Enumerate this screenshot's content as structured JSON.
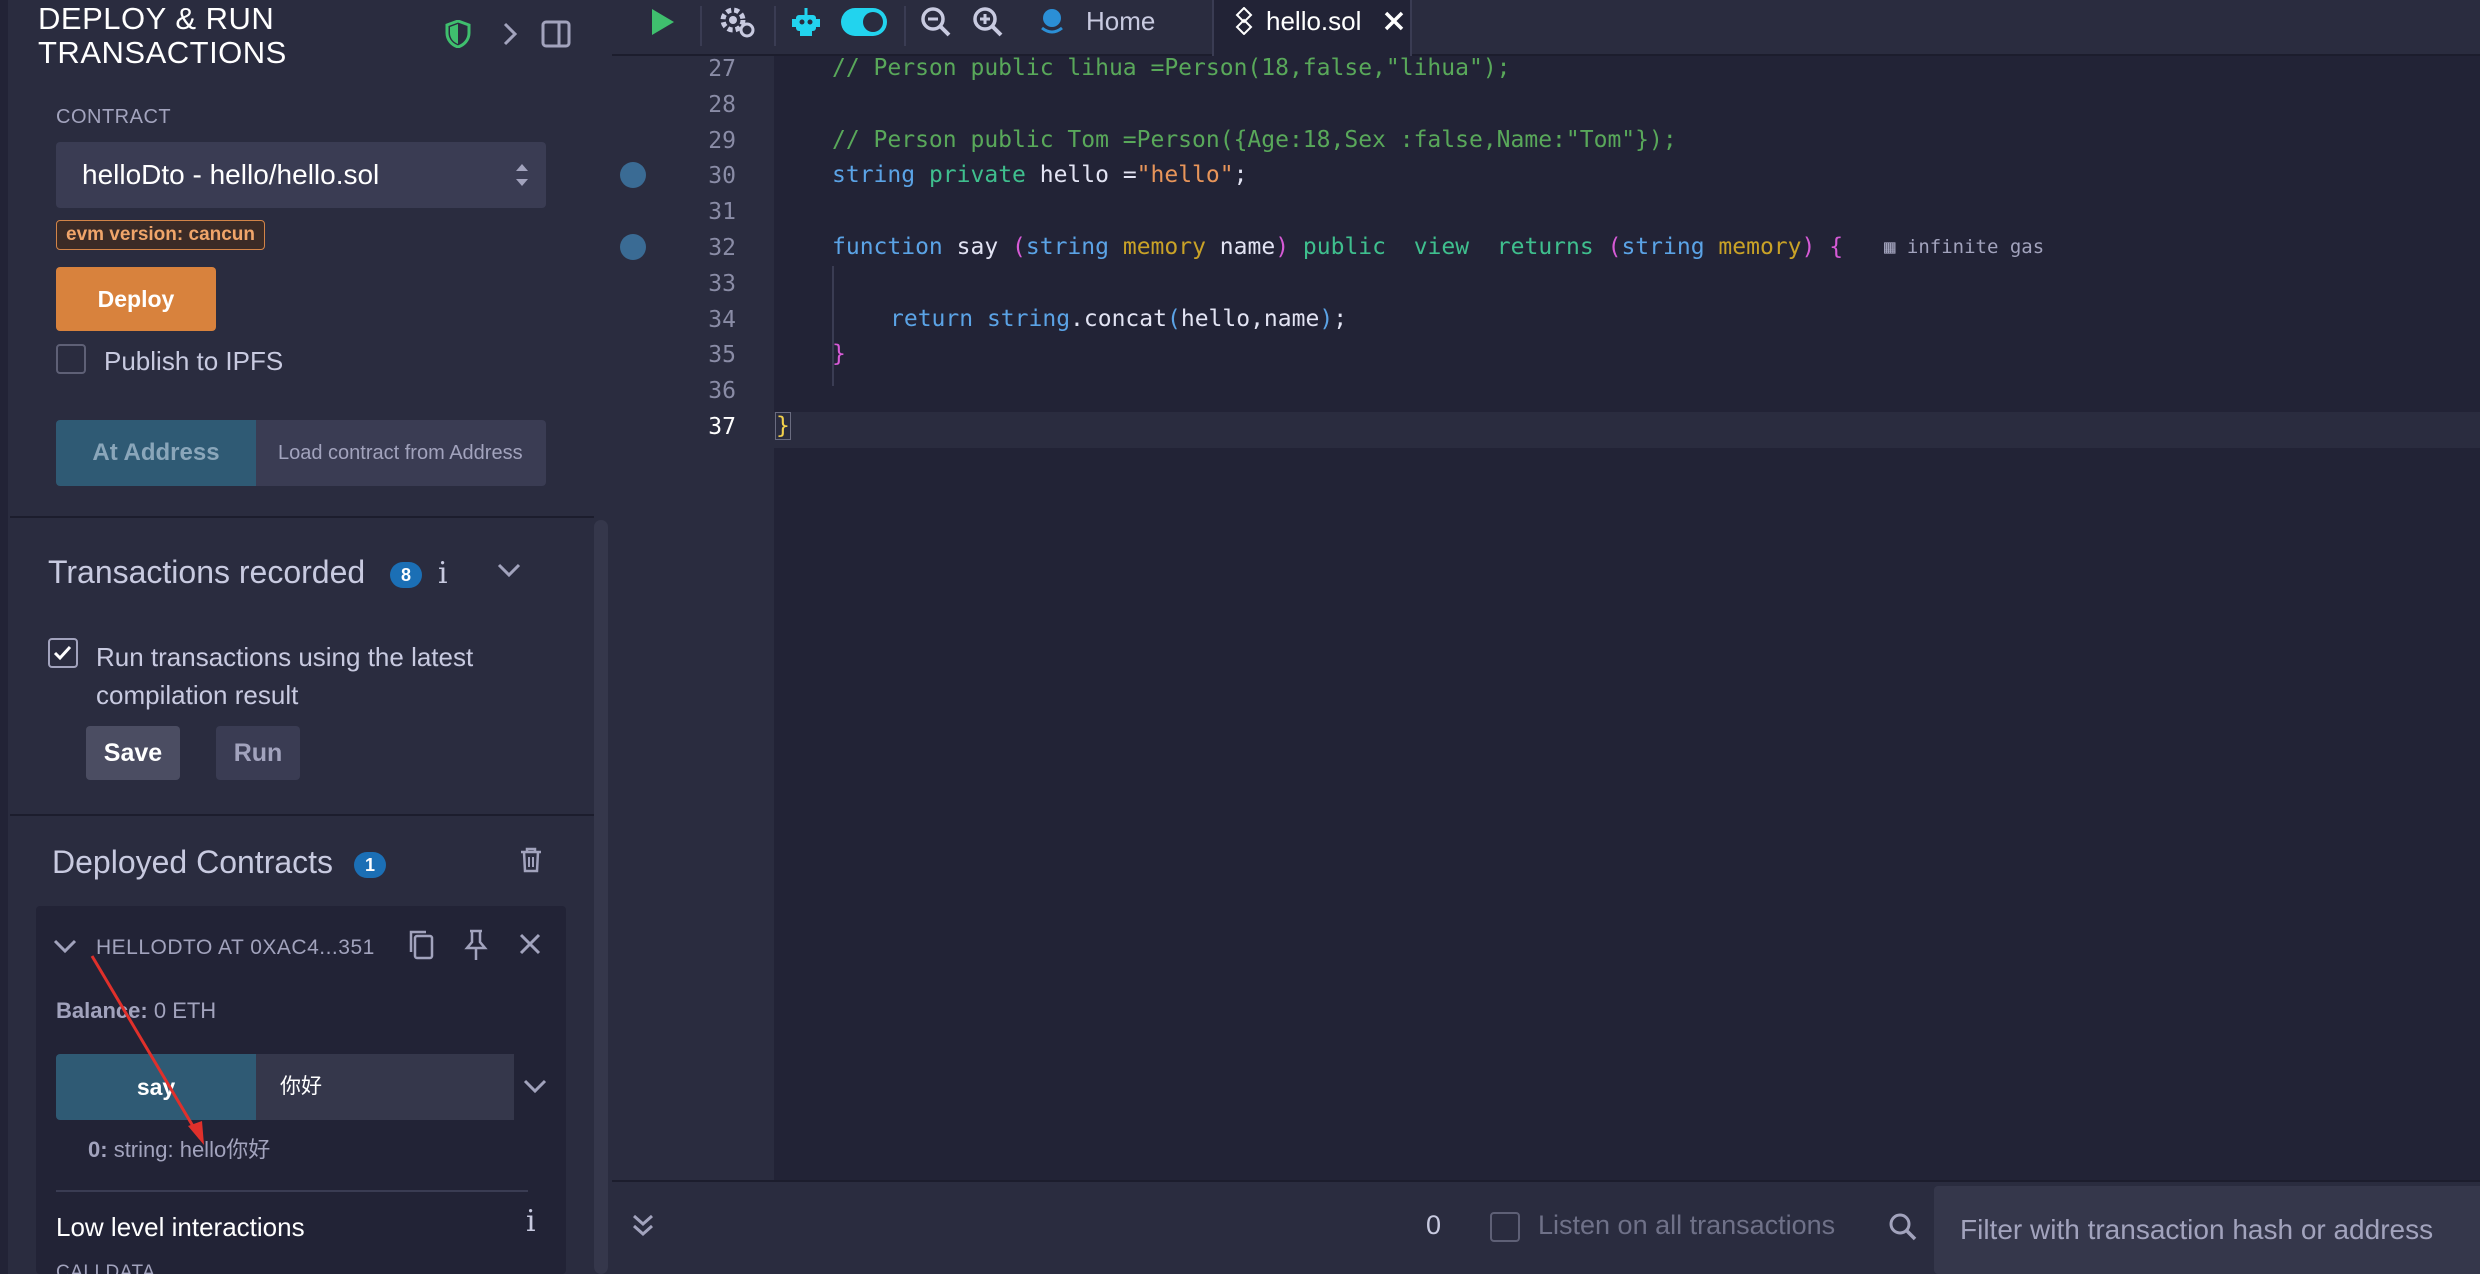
{
  "sidebar": {
    "title_line1": "DEPLOY & RUN",
    "title_line2": "TRANSACTIONS",
    "contract_label": "CONTRACT",
    "contract_selected": "helloDto - hello/hello.sol",
    "evm_badge": "evm version: cancun",
    "deploy_label": "Deploy",
    "publish_ipfs_label": "Publish to IPFS",
    "at_address_label": "At Address",
    "at_address_placeholder": "Load contract from Address",
    "transactions": {
      "title": "Transactions recorded",
      "count": "8",
      "run_latest_line1": "Run transactions using the latest",
      "run_latest_line2": "compilation result",
      "save_label": "Save",
      "run_label": "Run"
    },
    "deployed": {
      "title": "Deployed Contracts",
      "count": "1",
      "contract_name": "HELLODTO AT 0XAC4...351",
      "balance_label": "Balance:",
      "balance_value": "0 ETH",
      "say_label": "say",
      "say_input_value": "你好",
      "result_index": "0:",
      "result_value": "string: hello你好",
      "low_level_label": "Low level interactions",
      "calldata_label": "CALLDATA"
    }
  },
  "topbar": {
    "home_tab": "Home",
    "file_tab": "hello.sol"
  },
  "editor": {
    "line_numbers": [
      "27",
      "28",
      "29",
      "30",
      "31",
      "32",
      "33",
      "34",
      "35",
      "36",
      "37"
    ],
    "current_line": "37",
    "breakpoint_lines": [
      "30",
      "32"
    ],
    "gas_hint": "infinite gas",
    "code": {
      "l27": "// Person public lihua =Person(18,false,\"lihua\");",
      "l29": "// Person public Tom =Person({Age:18,Sex :false,Name:\"Tom\"});",
      "l30_kw1": "string",
      "l30_kw2": "private",
      "l30_name": " hello =",
      "l30_str": "\"hello\"",
      "l30_end": ";",
      "l32_fn": "function",
      "l32_name": " say ",
      "l32_p1": "(",
      "l32_type": "string",
      "l32_mem": "memory",
      "l32_arg": " name",
      "l32_p2": ")",
      "l32_pub": "public",
      "l32_view": "view",
      "l32_ret": "returns",
      "l32_p3": "(",
      "l32_type2": "string",
      "l32_mem2": "memory",
      "l32_p4": ")",
      "l32_brace": "{",
      "l34_ret": "return",
      "l34_str": "string",
      "l34_call": ".concat",
      "l34_p1": "(",
      "l34_args": "hello,name",
      "l34_p2": ")",
      "l34_end": ";",
      "l35": "}",
      "l37": "}"
    }
  },
  "bottombar": {
    "tx_count": "0",
    "listen_label": "Listen on all transactions",
    "filter_placeholder": "Filter with transaction hash or address"
  },
  "colors": {
    "accent_deploy": "#d8823d",
    "accent_blue": "#2f5a74",
    "badge_blue": "#1b6fb5",
    "toggle_cyan": "#22d3ee",
    "annotation_arrow": "#e0302b"
  }
}
